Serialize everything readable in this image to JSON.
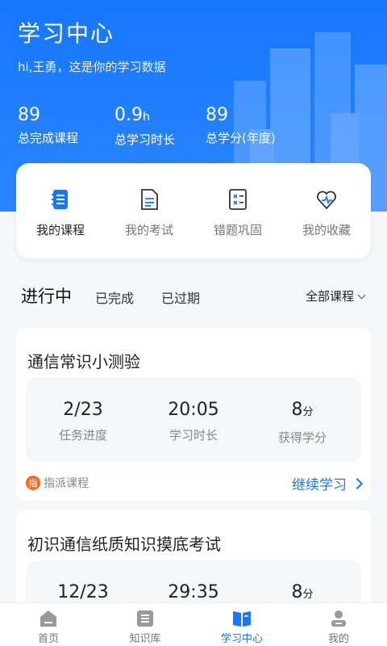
{
  "header": {
    "title": "学习中心",
    "greeting": "hi,王勇，这是你的学习数据",
    "stats": [
      {
        "value": "89",
        "unit": "",
        "label": "总完成课程"
      },
      {
        "value": "0.9",
        "unit": "h",
        "label": "总学习时长"
      },
      {
        "value": "89",
        "unit": "",
        "label": "总学分(年度)"
      }
    ]
  },
  "quick": [
    {
      "label": "我的课程",
      "icon": "course-book-icon"
    },
    {
      "label": "我的考试",
      "icon": "exam-paper-icon"
    },
    {
      "label": "错题巩固",
      "icon": "wrong-questions-icon"
    },
    {
      "label": "我的收藏",
      "icon": "favorite-heart-icon"
    }
  ],
  "tabs": {
    "items": [
      "进行中",
      "已完成",
      "已过期"
    ],
    "filter": "全部课程"
  },
  "cards": [
    {
      "name": "通信常识小测验",
      "progress": "2/23",
      "progress_label": "任务进度",
      "time": "20:05",
      "time_label": "学习时长",
      "credit": "8",
      "credit_unit": "分",
      "credit_label": "获得学分",
      "tag_badge": "指",
      "tag": "指派课程",
      "action": "继续学习"
    },
    {
      "name": "初识通信纸质知识摸底考试",
      "progress": "12/23",
      "time": "29:35",
      "credit": "8",
      "credit_unit": "分"
    }
  ],
  "nav": [
    {
      "label": "首页",
      "icon": "home-icon"
    },
    {
      "label": "知识库",
      "icon": "knowledge-base-icon"
    },
    {
      "label": "学习中心",
      "icon": "study-center-book-icon"
    },
    {
      "label": "我的",
      "icon": "profile-icon"
    }
  ],
  "colors": {
    "accent": "#1677ff",
    "badge": "#ff6a1a"
  }
}
